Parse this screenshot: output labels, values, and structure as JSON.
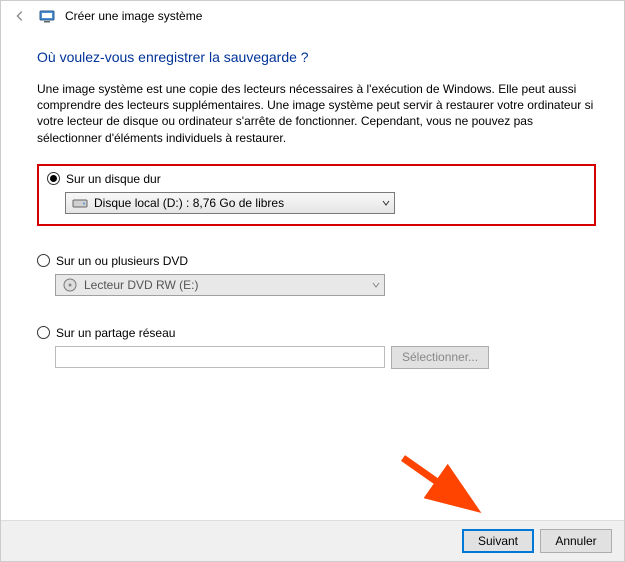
{
  "titlebar": {
    "title": "Créer une image système"
  },
  "heading": "Où voulez-vous enregistrer la sauvegarde ?",
  "description": "Une image système est une copie des lecteurs nécessaires à l'exécution de Windows. Elle peut aussi comprendre des lecteurs supplémentaires. Une image système peut servir à restaurer votre ordinateur si votre lecteur de disque ou ordinateur s'arrête de fonctionner. Cependant, vous ne pouvez pas sélectionner d'éléments individuels à restaurer.",
  "options": {
    "hdd": {
      "label": "Sur un disque dur",
      "selected_value": "Disque local (D:) : 8,76 Go de libres"
    },
    "dvd": {
      "label": "Sur un ou plusieurs DVD",
      "selected_value": "Lecteur DVD RW (E:)"
    },
    "network": {
      "label": "Sur un partage réseau",
      "browse_label": "Sélectionner..."
    }
  },
  "footer": {
    "next": "Suivant",
    "cancel": "Annuler"
  }
}
